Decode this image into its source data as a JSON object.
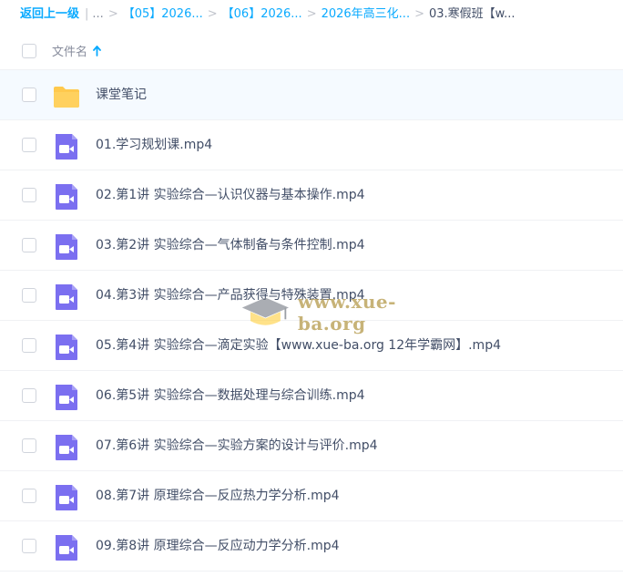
{
  "breadcrumb": {
    "back_label": "返回上一级",
    "ellipsis": "...",
    "items": [
      {
        "label": "【05】2026..."
      },
      {
        "label": "【06】2026..."
      },
      {
        "label": "2026年高三化..."
      }
    ],
    "current": "03.寒假班【w..."
  },
  "header": {
    "column_label": "文件名",
    "sort_icon": "arrow-up-icon"
  },
  "files": [
    {
      "name": "课堂笔记",
      "type": "folder",
      "icon": "folder-icon"
    },
    {
      "name": "01.学习规划课.mp4",
      "type": "video",
      "icon": "video-file-icon"
    },
    {
      "name": "02.第1讲 实验综合—认识仪器与基本操作.mp4",
      "type": "video",
      "icon": "video-file-icon"
    },
    {
      "name": "03.第2讲 实验综合—气体制备与条件控制.mp4",
      "type": "video",
      "icon": "video-file-icon"
    },
    {
      "name": "04.第3讲 实验综合—产品获得与特殊装置.mp4",
      "type": "video",
      "icon": "video-file-icon"
    },
    {
      "name": "05.第4讲 实验综合—滴定实验【www.xue-ba.org 12年学霸网】.mp4",
      "type": "video",
      "icon": "video-file-icon"
    },
    {
      "name": "06.第5讲 实验综合—数据处理与综合训练.mp4",
      "type": "video",
      "icon": "video-file-icon"
    },
    {
      "name": "07.第6讲 实验综合—实验方案的设计与评价.mp4",
      "type": "video",
      "icon": "video-file-icon"
    },
    {
      "name": "08.第7讲 原理综合—反应热力学分析.mp4",
      "type": "video",
      "icon": "video-file-icon"
    },
    {
      "name": "09.第8讲 原理综合—反应动力学分析.mp4",
      "type": "video",
      "icon": "video-file-icon"
    }
  ],
  "watermark": {
    "text": "www.xue-ba.org",
    "icon": "graduation-cap-icon"
  },
  "colors": {
    "link": "#09aaff",
    "text": "#424e67",
    "muted": "#878c9c",
    "folder": "#ffc94d",
    "video": "#7b6ff0",
    "row_highlight": "#f5faff"
  }
}
